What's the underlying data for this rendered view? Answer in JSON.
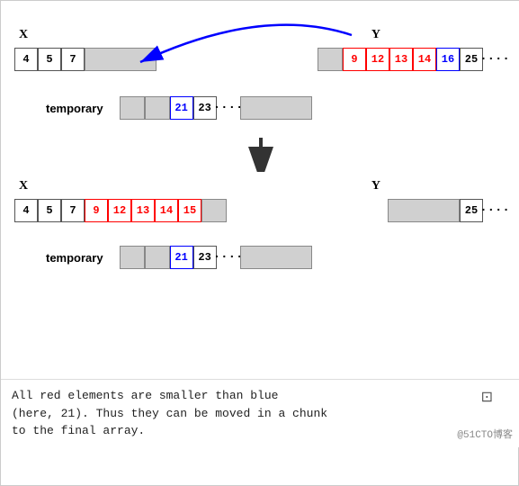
{
  "diagram": {
    "top": {
      "label_x": "X",
      "label_y": "Y",
      "x_cells": [
        "4",
        "5",
        "7"
      ],
      "y_cells_normal": [
        "25",
        "...."
      ],
      "y_cells_red": [
        "9",
        "12",
        "13",
        "14"
      ],
      "y_cells_blue": [
        "16"
      ]
    },
    "temporary": {
      "label": "temporary",
      "cells_blue": [
        "21"
      ],
      "cells_normal": [
        "23",
        "...."
      ]
    },
    "bottom": {
      "label_x": "X",
      "label_y": "Y",
      "x_cells_normal": [
        "4",
        "5",
        "7"
      ],
      "x_cells_red": [
        "9",
        "12",
        "13",
        "14",
        "15"
      ],
      "y_cell_normal": [
        "25",
        "...."
      ]
    },
    "temporary2": {
      "label": "temporary",
      "cells_blue": [
        "21"
      ],
      "cells_normal": [
        "23",
        "...."
      ]
    }
  },
  "text": {
    "line1": "All red elements are smaller than blue",
    "line2": "(here, 21). Thus they can be moved in a chunk",
    "line3": "to the final array."
  },
  "watermark": "@51CTO博客",
  "copy_icon": "⊡"
}
